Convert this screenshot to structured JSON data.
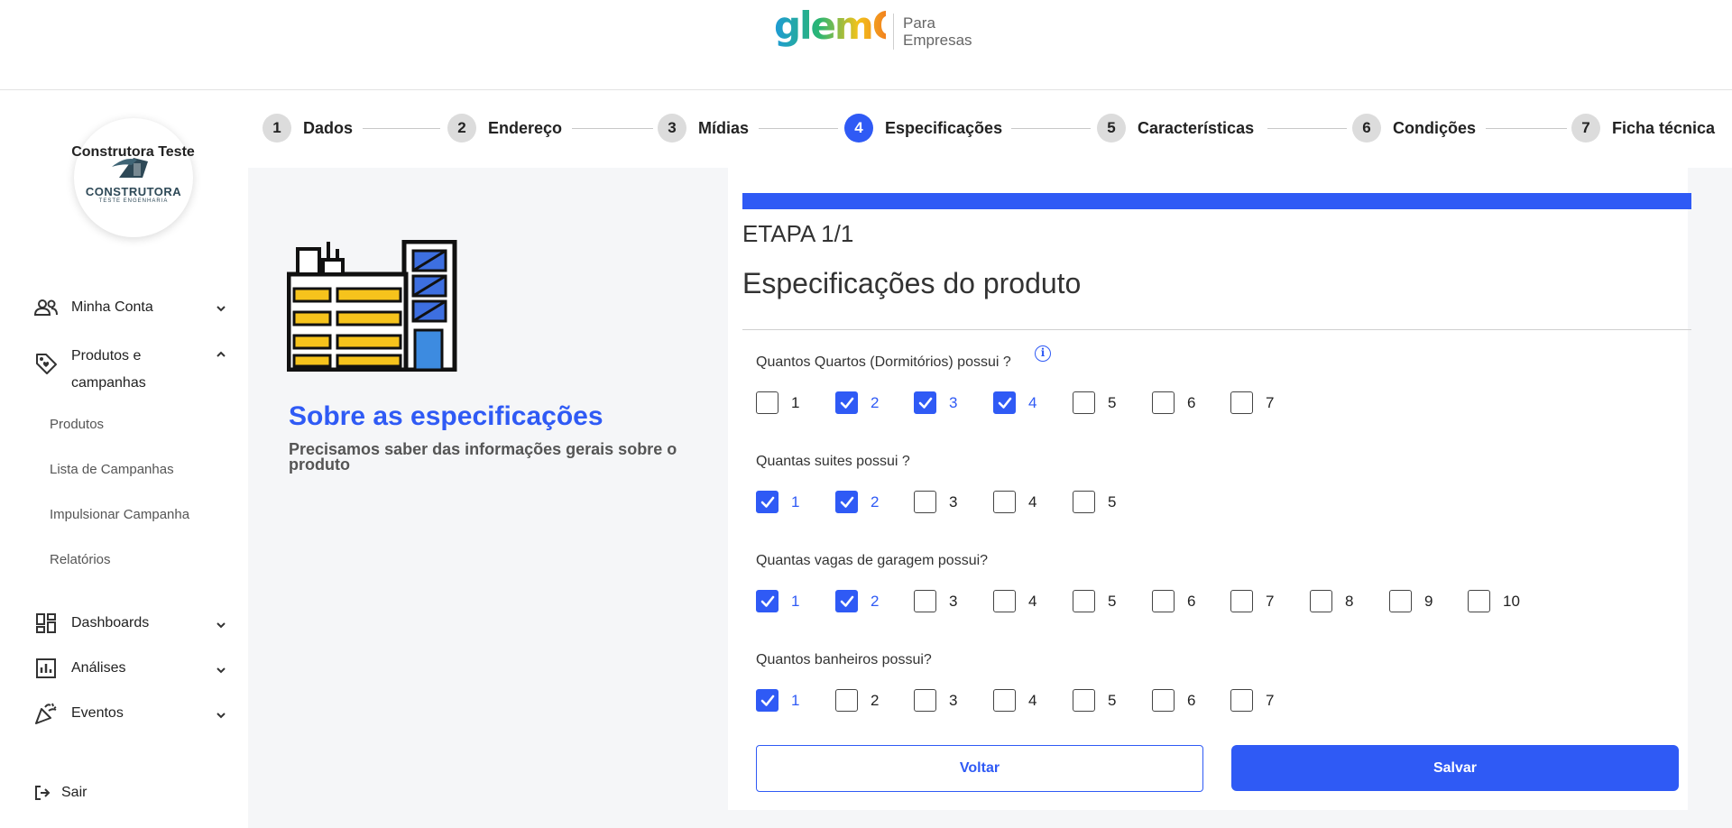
{
  "header": {
    "logo_text": "glemO",
    "logo_sub_line1": "Para",
    "logo_sub_line2": "Empresas"
  },
  "sidebar": {
    "avatar_line1": "CONSTRUTORA",
    "avatar_line2": "TESTE ENGENHARIA",
    "company_name": "Construtora Teste",
    "items": [
      {
        "label": "Minha Conta",
        "icon": "people-icon"
      },
      {
        "label_line1": "Produtos e",
        "label_line2": "campanhas",
        "icon": "tag-icon"
      },
      {
        "label": "Dashboards",
        "icon": "dashboard-icon"
      },
      {
        "label": "Análises",
        "icon": "analytics-icon"
      },
      {
        "label": "Eventos",
        "icon": "celebration-icon"
      }
    ],
    "subitems": [
      "Produtos",
      "Lista de Campanhas",
      "Impulsionar Campanha",
      "Relatórios"
    ],
    "logout": "Sair"
  },
  "stepper": [
    {
      "num": "1",
      "label": "Dados"
    },
    {
      "num": "2",
      "label": "Endereço"
    },
    {
      "num": "3",
      "label": "Mídias"
    },
    {
      "num": "4",
      "label": "Especificações",
      "active": true
    },
    {
      "num": "5",
      "label": "Características"
    },
    {
      "num": "6",
      "label": "Condições"
    },
    {
      "num": "7",
      "label": "Ficha técnica"
    }
  ],
  "info": {
    "title": "Sobre as especificações",
    "description": "Precisamos saber das informações gerais sobre o produto"
  },
  "form": {
    "etapa": "ETAPA 1/1",
    "title": "Especificações do produto",
    "questions": [
      {
        "label": "Quantos Quartos (Dormitórios) possui ?",
        "options": [
          "1",
          "2",
          "3",
          "4",
          "5",
          "6",
          "7"
        ],
        "checked": [
          false,
          true,
          true,
          true,
          false,
          false,
          false
        ]
      },
      {
        "label": "Quantas suites possui ?",
        "options": [
          "1",
          "2",
          "3",
          "4",
          "5"
        ],
        "checked": [
          true,
          true,
          false,
          false,
          false
        ]
      },
      {
        "label": "Quantas vagas de garagem possui?",
        "options": [
          "1",
          "2",
          "3",
          "4",
          "5",
          "6",
          "7",
          "8",
          "9",
          "10"
        ],
        "checked": [
          true,
          true,
          false,
          false,
          false,
          false,
          false,
          false,
          false,
          false
        ]
      },
      {
        "label": "Quantos banheiros possui?",
        "options": [
          "1",
          "2",
          "3",
          "4",
          "5",
          "6",
          "7"
        ],
        "checked": [
          true,
          false,
          false,
          false,
          false,
          false,
          false
        ]
      }
    ],
    "back_button": "Voltar",
    "save_button": "Salvar"
  },
  "colors": {
    "primary": "#2f5af5",
    "step_inactive": "#dcdcdc",
    "content_bg": "#f5f6f8"
  }
}
